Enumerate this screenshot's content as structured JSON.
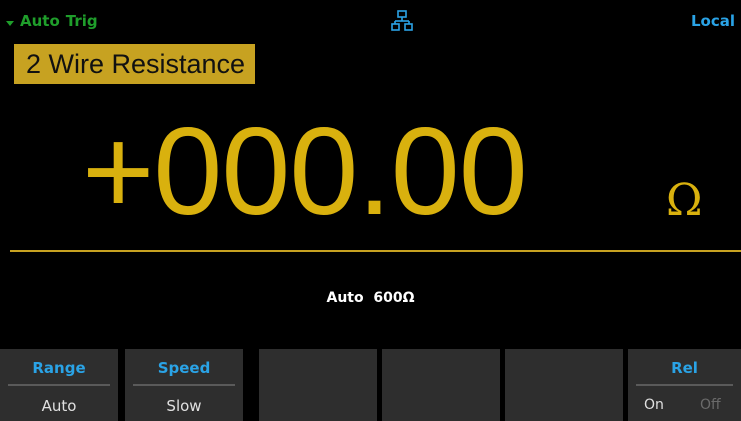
{
  "status_bar": {
    "trigger_mode": [
      "Auto",
      "Trig"
    ],
    "connection": "Local",
    "lan_icon": "network-icon",
    "trigger_icon": "trigger-arrow-icon"
  },
  "measurement": {
    "function": "2 Wire Resistance",
    "reading": "+000.00",
    "unit": "Ω",
    "range_mode": "Auto",
    "range_value": "600Ω"
  },
  "softkeys": [
    {
      "label": "Range",
      "value": "Auto"
    },
    {
      "label": "Speed",
      "value": "Slow"
    },
    {
      "label": "",
      "value": ""
    },
    {
      "label": "",
      "value": ""
    },
    {
      "label": "",
      "value": ""
    },
    {
      "label": "Rel",
      "options": [
        "On",
        "Off"
      ],
      "selected": "On"
    }
  ],
  "colors": {
    "background": "#000000",
    "accent": "#d9b10e",
    "title_bg": "#c7a221",
    "trigger": "#1f9e2b",
    "softkey_label": "#2aa3e6",
    "softkey_bg": "#2e2e2e"
  }
}
